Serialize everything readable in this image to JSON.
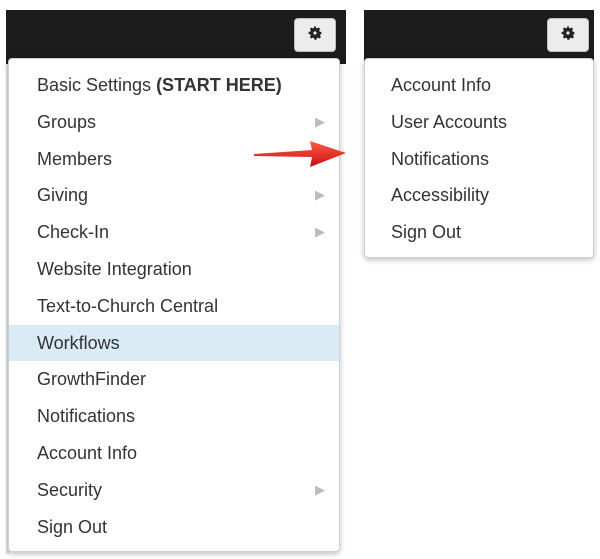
{
  "left_menu": {
    "items": [
      {
        "label": "Basic Settings ",
        "bold": "(START HERE)",
        "submenu": false
      },
      {
        "label": "Groups",
        "submenu": true
      },
      {
        "label": "Members",
        "submenu": false
      },
      {
        "label": "Giving",
        "submenu": true
      },
      {
        "label": "Check-In",
        "submenu": true
      },
      {
        "label": "Website Integration",
        "submenu": false
      },
      {
        "label": "Text-to-Church Central",
        "submenu": false
      },
      {
        "label": "Workflows",
        "submenu": false,
        "highlighted": true
      },
      {
        "label": "GrowthFinder",
        "submenu": false
      },
      {
        "label": "Notifications",
        "submenu": false
      },
      {
        "label": "Account Info",
        "submenu": false
      },
      {
        "label": "Security",
        "submenu": true
      },
      {
        "label": "Sign Out",
        "submenu": false
      }
    ]
  },
  "right_menu": {
    "items": [
      {
        "label": "Account Info"
      },
      {
        "label": "User Accounts"
      },
      {
        "label": "Notifications"
      },
      {
        "label": "Accessibility"
      },
      {
        "label": "Sign Out"
      }
    ]
  },
  "icons": {
    "settings": "gear-icon",
    "submenu": "chevron-right-icon",
    "pointer": "red-arrow-icon"
  },
  "colors": {
    "header_bar": "#1c1c1c",
    "highlight": "#d9ebf5",
    "arrow": "#e8201c"
  }
}
